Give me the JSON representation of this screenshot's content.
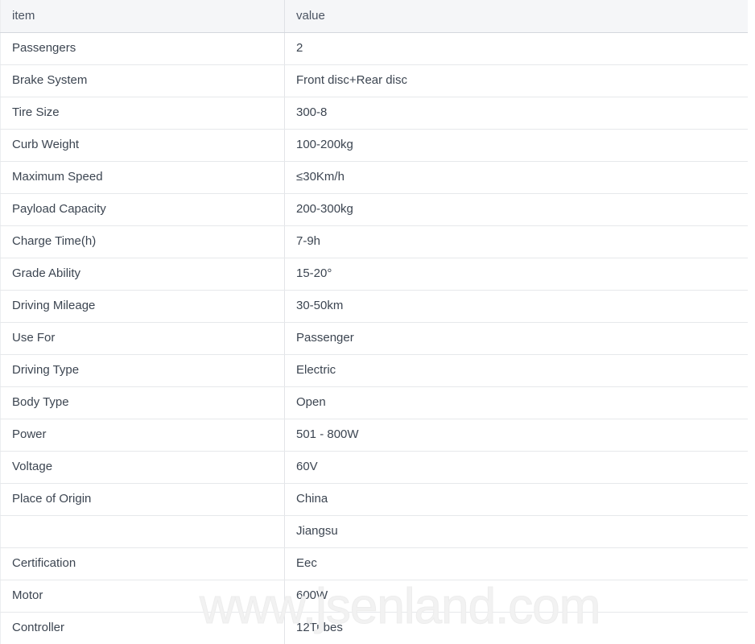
{
  "table": {
    "columns": [
      "item",
      "value"
    ],
    "rows": [
      {
        "item": "Passengers",
        "value": "2"
      },
      {
        "item": "Brake System",
        "value": "Front disc+Rear disc"
      },
      {
        "item": "Tire Size",
        "value": "300-8"
      },
      {
        "item": "Curb Weight",
        "value": "100-200kg"
      },
      {
        "item": "Maximum Speed",
        "value": "≤30Km/h"
      },
      {
        "item": "Payload Capacity",
        "value": "200-300kg"
      },
      {
        "item": "Charge Time(h)",
        "value": "7-9h"
      },
      {
        "item": "Grade Ability",
        "value": "15-20°"
      },
      {
        "item": "Driving Mileage",
        "value": "30-50km"
      },
      {
        "item": "Use For",
        "value": "Passenger"
      },
      {
        "item": "Driving Type",
        "value": "Electric"
      },
      {
        "item": "Body Type",
        "value": "Open"
      },
      {
        "item": "Power",
        "value": "501 - 800W"
      },
      {
        "item": "Voltage",
        "value": "60V"
      },
      {
        "item": "Place of Origin",
        "value": "China"
      },
      {
        "item": "",
        "value": "Jiangsu"
      },
      {
        "item": "Certification",
        "value": "Eec"
      },
      {
        "item": "Motor",
        "value": "600W"
      },
      {
        "item": "Controller",
        "value": "12Tubes"
      }
    ]
  },
  "watermark": {
    "text": "www.jsenland.com"
  },
  "colors": {
    "header_background": "#f5f6f8",
    "text": "#3c4551",
    "row_border": "#e6e8eb",
    "watermark": "#f2f2f2"
  }
}
